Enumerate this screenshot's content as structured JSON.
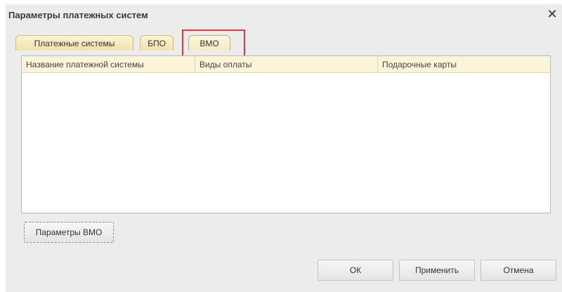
{
  "window": {
    "title": "Параметры платежных систем",
    "close_glyph": "✕"
  },
  "tabs": [
    {
      "label": "Платежные системы"
    },
    {
      "label": "БПО"
    },
    {
      "label": "ВМО",
      "selected": true
    }
  ],
  "table": {
    "columns": [
      "Название платежной системы",
      "Виды оплаты",
      "Подарочные карты"
    ],
    "rows": []
  },
  "buttons": {
    "params": "Параметры ВМО",
    "ok": "ОК",
    "apply": "Применить",
    "cancel": "Отмена"
  },
  "colors": {
    "highlight": "#e3343c",
    "tab_fill": "#efe3ad",
    "header_fill": "#fbf4d8"
  }
}
